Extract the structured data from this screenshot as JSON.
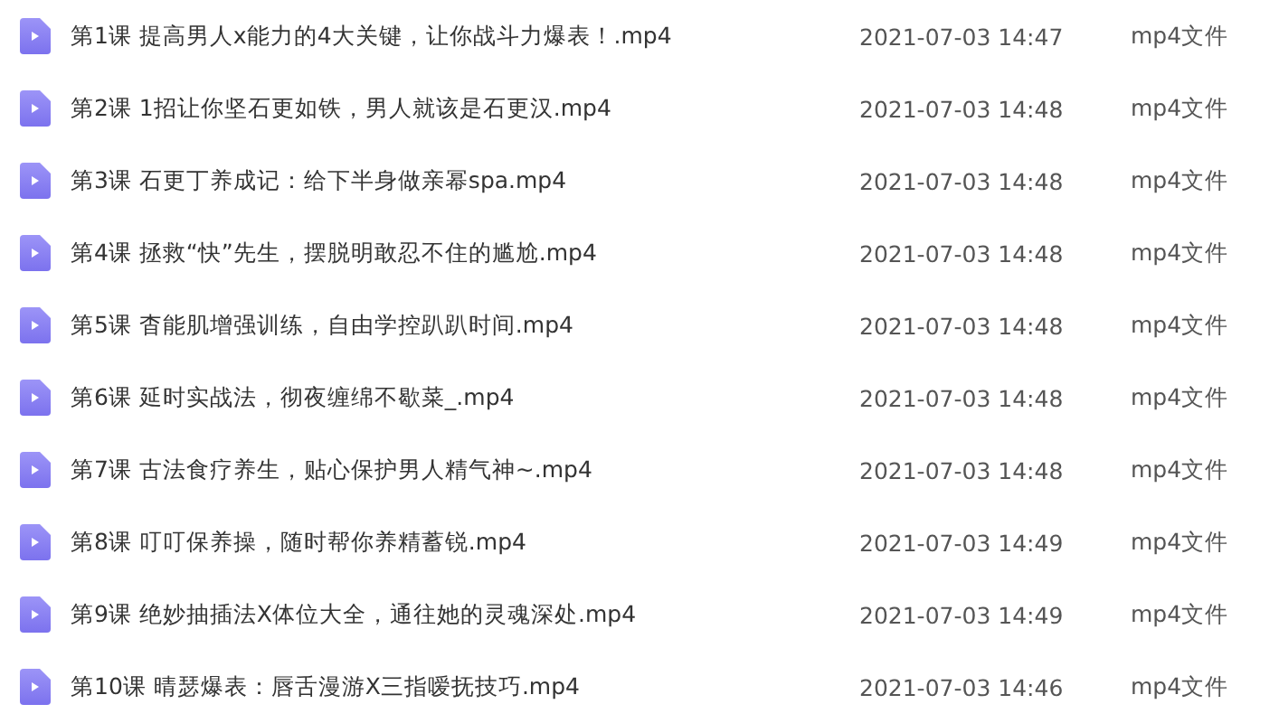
{
  "files": [
    {
      "name": "第1课 提高男人x能力的4大关键，让你战斗力爆表！.mp4",
      "modified": "2021-07-03 14:47",
      "type": "mp4文件"
    },
    {
      "name": "第2课 1招让你坚石更如铁，男人就该是石更汉.mp4",
      "modified": "2021-07-03 14:48",
      "type": "mp4文件"
    },
    {
      "name": "第3课 石更丁养成记：给下半身做亲幂spa.mp4",
      "modified": "2021-07-03 14:48",
      "type": "mp4文件"
    },
    {
      "name": "第4课 拯救“快”先生，摆脱明敢忍不住的尴尬.mp4",
      "modified": "2021-07-03 14:48",
      "type": "mp4文件"
    },
    {
      "name": "第5课 杳能肌增强训练，自由学控趴趴时间.mp4",
      "modified": "2021-07-03 14:48",
      "type": "mp4文件"
    },
    {
      "name": "第6课 延时实战法，彻夜缠绵不歇菜_.mp4",
      "modified": "2021-07-03 14:48",
      "type": "mp4文件"
    },
    {
      "name": "第7课 古法食疗养生，贴心保护男人精气神~.mp4",
      "modified": "2021-07-03 14:48",
      "type": "mp4文件"
    },
    {
      "name": "第8课 叮叮保养操，随时帮你养精蓄锐.mp4",
      "modified": "2021-07-03 14:49",
      "type": "mp4文件"
    },
    {
      "name": "第9课 绝妙抽插法X体位大全，通往她的灵魂深处.mp4",
      "modified": "2021-07-03 14:49",
      "type": "mp4文件"
    },
    {
      "name": "第10课 晴瑟爆表：唇舌漫游X三指嗳抚技巧.mp4",
      "modified": "2021-07-03 14:46",
      "type": "mp4文件"
    }
  ]
}
